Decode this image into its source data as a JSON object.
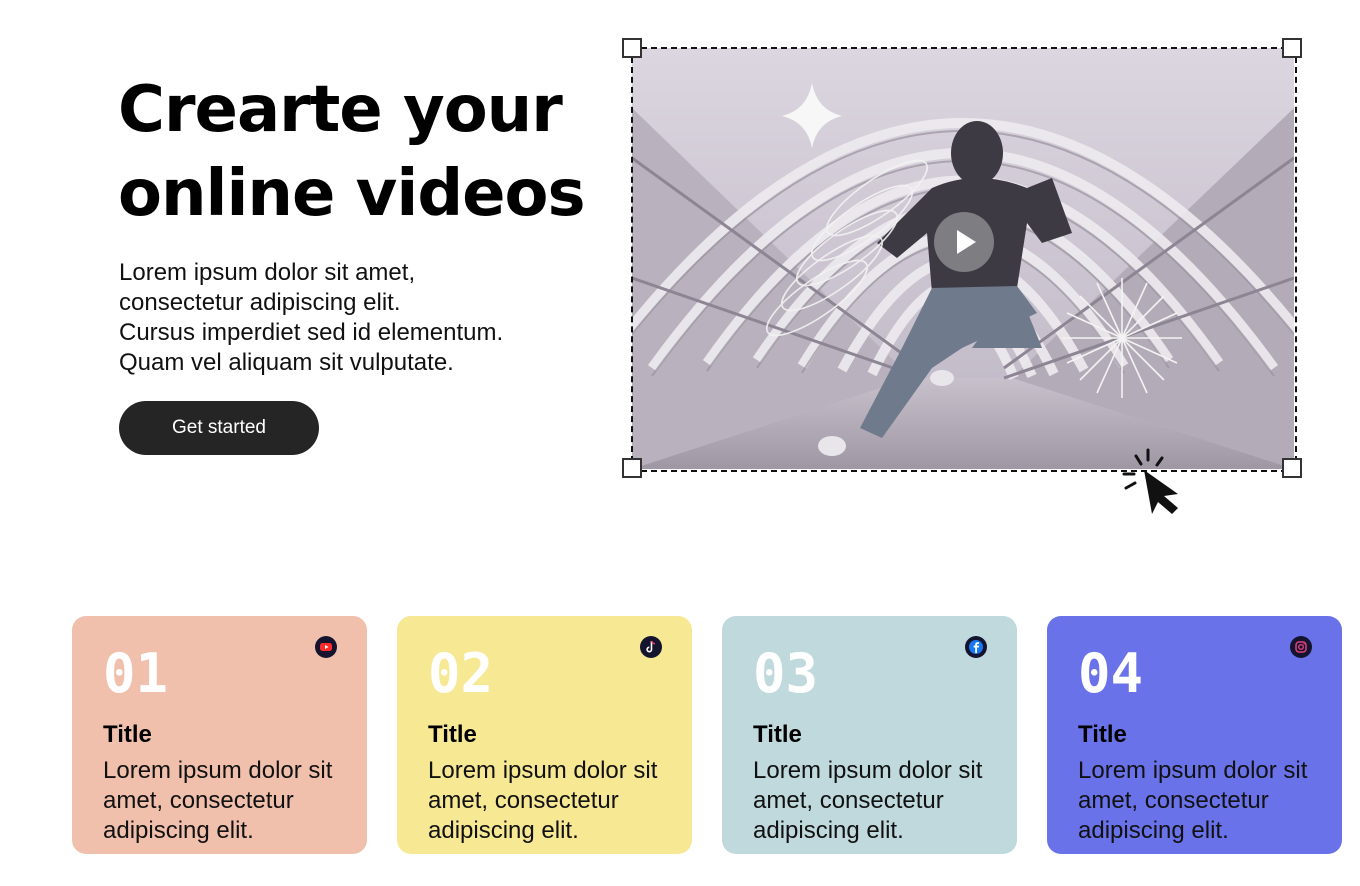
{
  "hero": {
    "title_line1": "Crearte your",
    "title_line2": "online videos",
    "desc_line1": "Lorem ipsum dolor sit amet,",
    "desc_line2": "consectetur adipiscing elit.",
    "desc_line3": "Cursus imperdiet sed id elementum.",
    "desc_line4": "Quam vel aliquam sit vulputate.",
    "cta_label": "Get started"
  },
  "cards": [
    {
      "number": "01",
      "title": "Title",
      "body": "Lorem ipsum dolor sit amet, consectetur adipiscing elit.",
      "icon": "youtube-icon",
      "color": "#f1c0ad"
    },
    {
      "number": "02",
      "title": "Title",
      "body": "Lorem ipsum dolor sit amet, consectetur adipiscing elit.",
      "icon": "tiktok-icon",
      "color": "#f7e894"
    },
    {
      "number": "03",
      "title": "Title",
      "body": "Lorem ipsum dolor sit amet, consectetur adipiscing elit.",
      "icon": "facebook-icon",
      "color": "#bfd9dd"
    },
    {
      "number": "04",
      "title": "Title",
      "body": "Lorem ipsum dolor sit amet, consectetur adipiscing elit.",
      "icon": "instagram-icon",
      "color": "#6a72ea"
    }
  ]
}
